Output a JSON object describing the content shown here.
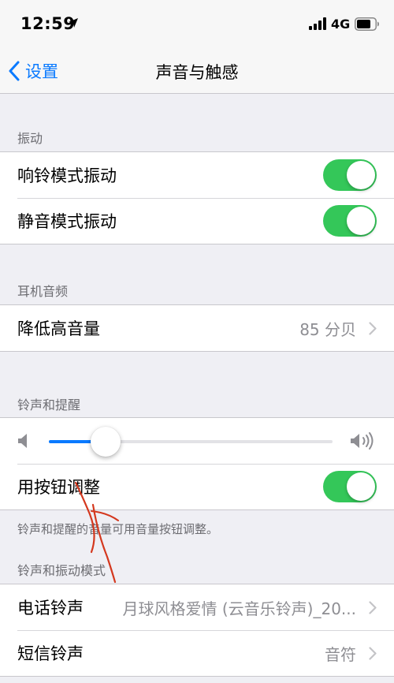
{
  "status_bar": {
    "time": "12:59",
    "network": "4G",
    "icons": [
      "location-icon",
      "signal-icon",
      "battery-icon"
    ]
  },
  "nav": {
    "back_label": "设置",
    "title": "声音与触感"
  },
  "vibration": {
    "header": "振动",
    "items": [
      {
        "label": "响铃模式振动",
        "on": true
      },
      {
        "label": "静音模式振动",
        "on": true
      }
    ]
  },
  "headphone": {
    "header": "耳机音频",
    "items": [
      {
        "label": "降低高音量",
        "value": "85 分贝"
      }
    ]
  },
  "ringer": {
    "header": "铃声和提醒",
    "volume_level": 0.2,
    "button_adjust": {
      "label": "用按钮调整",
      "on": true
    },
    "footer": "铃声和提醒的音量可用音量按钮调整。"
  },
  "patterns": {
    "header": "铃声和振动模式",
    "items": [
      {
        "label": "电话铃声",
        "value": "月球风格爱情 (云音乐铃声)_20..."
      },
      {
        "label": "短信铃声",
        "value": "音符"
      }
    ]
  },
  "colors": {
    "accent": "#0a7aff",
    "toggle_on": "#34c759",
    "annotation": "#d4381e"
  }
}
